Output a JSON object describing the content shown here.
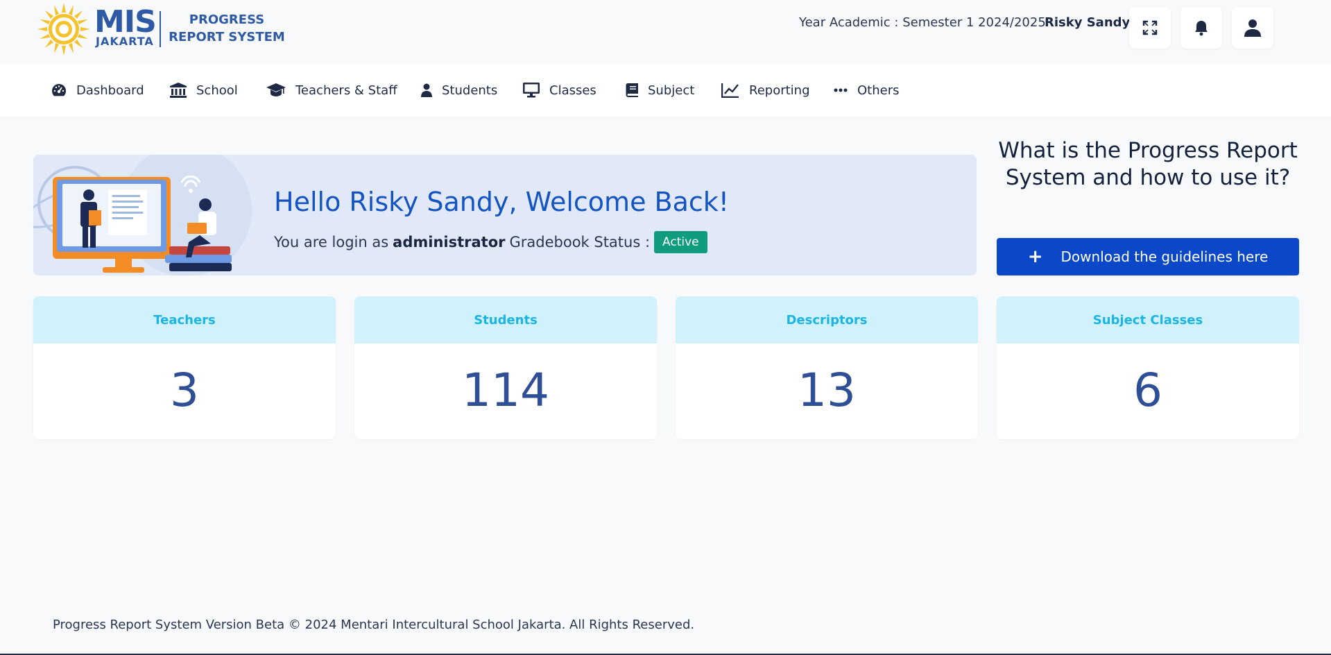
{
  "logo": {
    "mis": "MIS",
    "jakarta": "JAKARTA",
    "system_line1": "PROGRESS",
    "system_line2": "REPORT SYSTEM"
  },
  "header": {
    "year_academic": "Year Academic : Semester 1 2024/2025",
    "user_name": "Risky Sandy",
    "buttons": {
      "fullscreen": "fullscreen-icon",
      "notifications": "bell-icon",
      "profile": "user-icon"
    }
  },
  "nav": {
    "items": [
      {
        "label": "Dashboard",
        "icon": "dashboard-gauge-icon"
      },
      {
        "label": "School",
        "icon": "school-building-icon"
      },
      {
        "label": "Teachers & Staff",
        "icon": "graduation-cap-icon"
      },
      {
        "label": "Students",
        "icon": "user-icon"
      },
      {
        "label": "Classes",
        "icon": "monitor-icon"
      },
      {
        "label": "Subject",
        "icon": "book-icon"
      },
      {
        "label": "Reporting",
        "icon": "line-chart-icon"
      },
      {
        "label": "Others",
        "icon": "more-dots-icon"
      }
    ]
  },
  "welcome": {
    "greeting": "Hello Risky Sandy, Welcome Back!",
    "login_prefix": "You are login as",
    "role": "administrator",
    "status_label": "Gradebook Status :",
    "status_badge": "Active"
  },
  "guide": {
    "title": "What is the Progress Report System and how to use it?",
    "button_label": "Download the guidelines here",
    "button_icon": "plus-icon"
  },
  "stats": [
    {
      "label": "Teachers",
      "value": "3"
    },
    {
      "label": "Students",
      "value": "114"
    },
    {
      "label": "Descriptors",
      "value": "13"
    },
    {
      "label": "Subject Classes",
      "value": "6"
    }
  ],
  "footer": {
    "text": "Progress Report System Version Beta © 2024 Mentari Intercultural School Jakarta. All Rights Reserved."
  },
  "colors": {
    "brand": "#2e5aa5",
    "primary_button": "#0a48c9",
    "welcome_text": "#1453c2",
    "active_badge": "#0f9d7e",
    "card_header_bg": "#d1f1fd",
    "card_header_text": "#1bb5e3",
    "stat_value": "#2e4f96"
  }
}
